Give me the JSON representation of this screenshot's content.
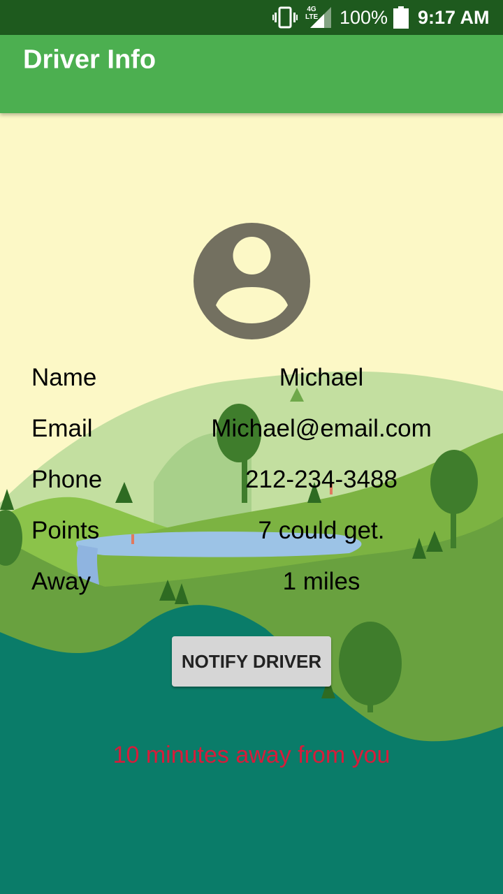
{
  "status_bar": {
    "network_label": "4G\nLTE",
    "battery": "100%",
    "time": "9:17 AM",
    "icons": [
      "vibrate-icon",
      "signal-icon",
      "battery-icon"
    ]
  },
  "app_bar": {
    "title": "Driver Info"
  },
  "driver": {
    "rows": [
      {
        "label": "Name",
        "value": "Michael"
      },
      {
        "label": "Email",
        "value": "Michael@email.com"
      },
      {
        "label": "Phone",
        "value": "212-234-3488"
      },
      {
        "label": "Points",
        "value": "7 could get."
      },
      {
        "label": "Away",
        "value": "1 miles"
      }
    ]
  },
  "notify_button": {
    "label": "NOTIFY DRIVER"
  },
  "away_message": "10 minutes away from you",
  "colors": {
    "status_bar": "#1e5a1e",
    "app_bar": "#4caf50",
    "background": "#fcf8c6",
    "away_text": "#d81b3a",
    "avatar": "#737060"
  }
}
